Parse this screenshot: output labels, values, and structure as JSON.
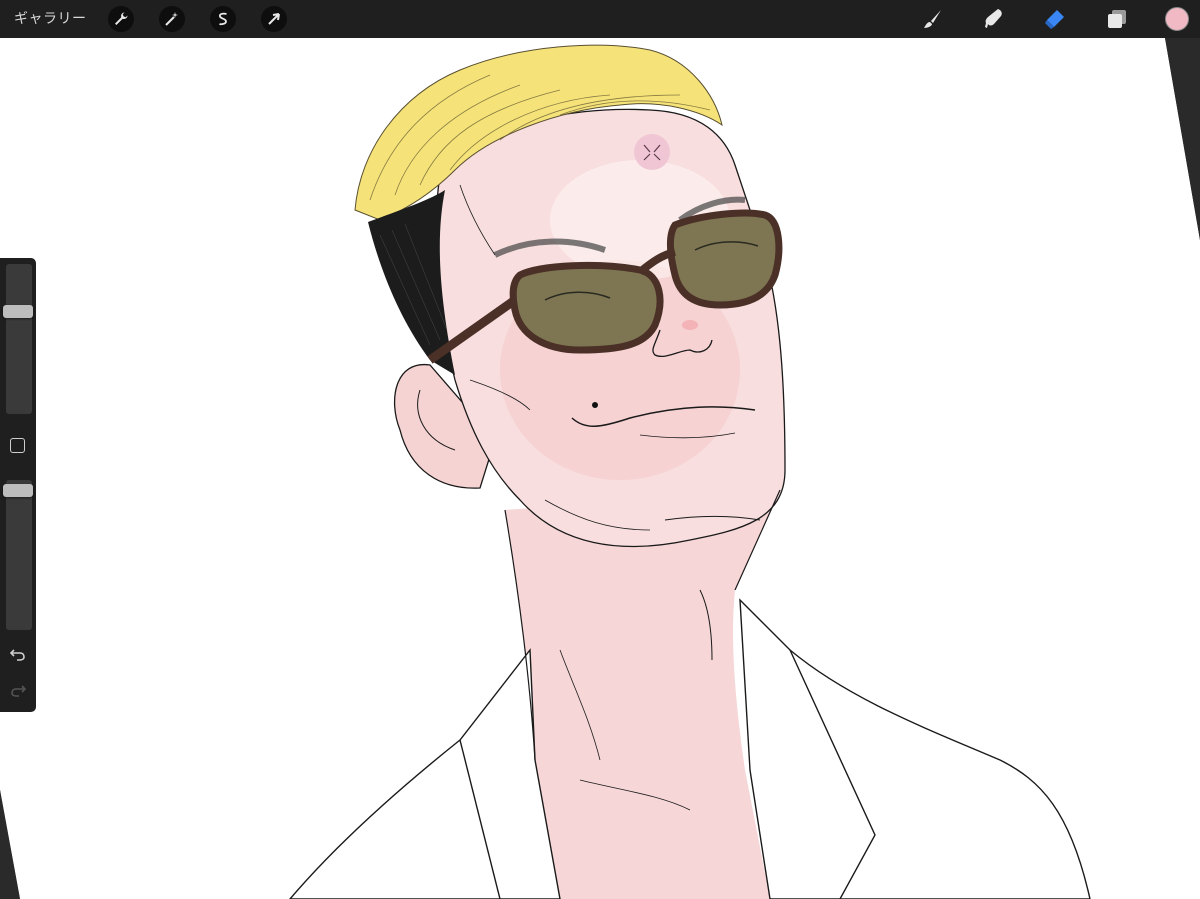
{
  "toolbar": {
    "gallery_label": "ギャラリー",
    "left_tools": [
      {
        "icon": "wrench-icon",
        "name": "actions"
      },
      {
        "icon": "magic-wand-icon",
        "name": "adjustments"
      },
      {
        "icon": "selection-s-icon",
        "name": "selection"
      },
      {
        "icon": "arrow-cursor-icon",
        "name": "transform"
      }
    ],
    "right_tools": [
      {
        "icon": "brush-icon",
        "name": "paint",
        "active": false
      },
      {
        "icon": "smudge-icon",
        "name": "smudge",
        "active": false
      },
      {
        "icon": "eraser-icon",
        "name": "erase",
        "active": true
      },
      {
        "icon": "layers-icon",
        "name": "layers",
        "active": false
      }
    ],
    "current_color": "#f1b9c4",
    "active_tool_color": "#3a86f5"
  },
  "sidebar": {
    "brush_size_level": 0.7,
    "opacity_level": 0.97,
    "undo_icon": "undo-icon",
    "redo_icon": "redo-icon",
    "modify_icon": "square-icon"
  },
  "artwork": {
    "hair_color": "#f5e37a",
    "skin_color": "#f7d9d9",
    "lens_color": "#7e7552",
    "frame_color": "#4a3026"
  }
}
